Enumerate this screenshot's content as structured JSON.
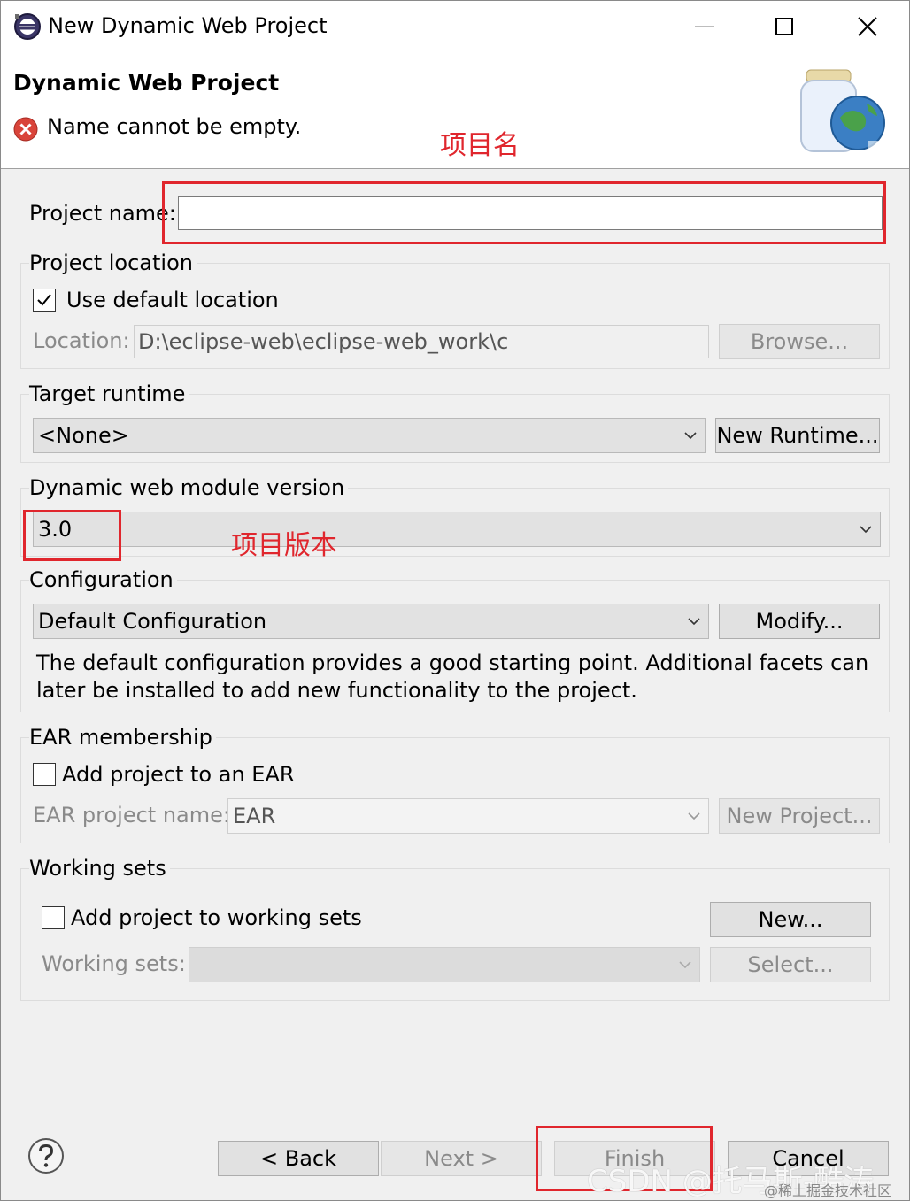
{
  "window": {
    "title": "New Dynamic Web Project"
  },
  "header": {
    "title": "Dynamic Web Project",
    "error_message": "Name cannot be empty."
  },
  "annotations": {
    "project_name": "项目名",
    "project_version": "项目版本"
  },
  "project_name": {
    "label": "Project name:",
    "value": ""
  },
  "project_location": {
    "group_label": "Project location",
    "use_default_label": "Use default location",
    "use_default_checked": true,
    "location_label": "Location:",
    "location_value": "D:\\eclipse-web\\eclipse-web_work\\c",
    "browse_label": "Browse..."
  },
  "target_runtime": {
    "group_label": "Target runtime",
    "selected": "<None>",
    "new_runtime_label": "New Runtime..."
  },
  "module_version": {
    "group_label": "Dynamic web module version",
    "selected": "3.0"
  },
  "configuration": {
    "group_label": "Configuration",
    "selected": "Default Configuration",
    "modify_label": "Modify...",
    "description": "The default configuration provides a good starting point. Additional facets can later be installed to add new functionality to the project."
  },
  "ear": {
    "group_label": "EAR membership",
    "add_label": "Add project to an EAR",
    "add_checked": false,
    "name_label": "EAR project name:",
    "name_value": "EAR",
    "new_project_label": "New Project..."
  },
  "working_sets": {
    "group_label": "Working sets",
    "add_label": "Add project to working sets",
    "add_checked": false,
    "new_label": "New...",
    "sets_label": "Working sets:",
    "select_label": "Select..."
  },
  "footer": {
    "back_label": "< Back",
    "next_label": "Next >",
    "finish_label": "Finish",
    "cancel_label": "Cancel"
  },
  "watermark": {
    "main": "CSDN @托马斯-酷涛",
    "sub": "@稀土掘金技术社区"
  },
  "colors": {
    "annotation_red": "#e0262d",
    "error_red": "#d9443a",
    "dialog_bg": "#f0f0f0"
  },
  "icons": [
    "eclipse-app-icon",
    "minimize-icon",
    "maximize-icon",
    "close-icon",
    "error-icon",
    "web-jar-globe-icon",
    "checkmark-icon",
    "chevron-down-icon",
    "help-icon"
  ]
}
